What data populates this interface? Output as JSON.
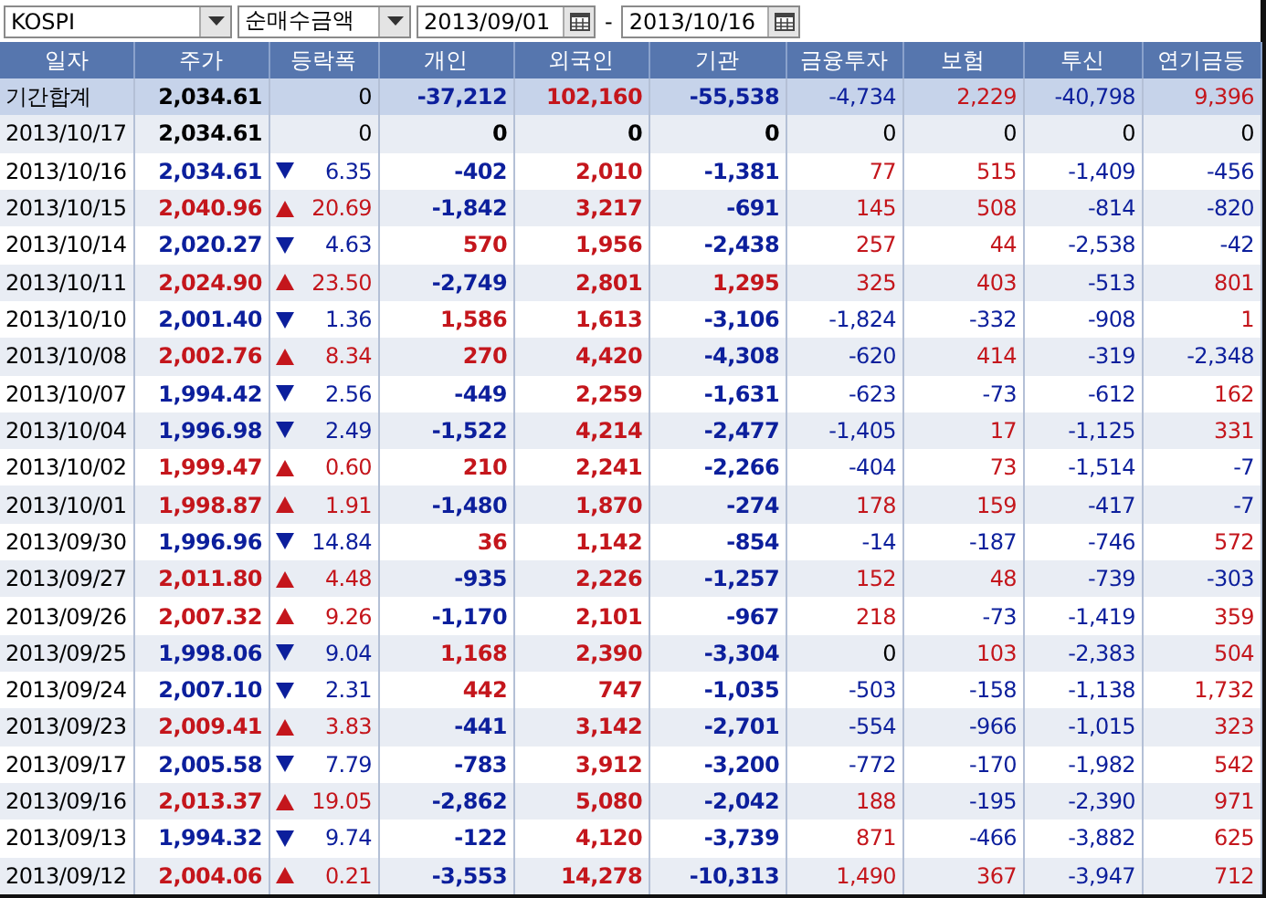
{
  "toolbar": {
    "market": "KOSPI",
    "metric": "순매수금액",
    "date_from": "2013/09/01",
    "separator": "-",
    "date_to": "2013/10/16"
  },
  "table": {
    "columns": [
      "일자",
      "주가",
      "등락폭",
      "개인",
      "외국인",
      "기관",
      "금융투자",
      "보험",
      "투신",
      "연기금등"
    ],
    "rows": [
      {
        "kind": "total",
        "date": "기간합계",
        "price": "2,034.61",
        "color": "#000000",
        "change": "0",
        "values": [
          {
            "text": "-37,212",
            "color": "#0c1f9c"
          },
          {
            "text": "102,160",
            "color": "#c4161c"
          },
          {
            "text": "-55,538",
            "color": "#0c1f9c"
          },
          {
            "text": "-4,734",
            "color": "#0c1f9c"
          },
          {
            "text": "2,229",
            "color": "#c4161c"
          },
          {
            "text": "-40,798",
            "color": "#0c1f9c"
          },
          {
            "text": "9,396",
            "color": "#c4161c"
          }
        ]
      },
      {
        "kind": "flat",
        "date": "2013/10/17",
        "price": "2,034.61",
        "color": "#000000",
        "change": "0",
        "values": [
          {
            "text": "0",
            "color": "#000000"
          },
          {
            "text": "0",
            "color": "#000000"
          },
          {
            "text": "0",
            "color": "#000000"
          },
          {
            "text": "0",
            "color": "#000000"
          },
          {
            "text": "0",
            "color": "#000000"
          },
          {
            "text": "0",
            "color": "#000000"
          },
          {
            "text": "0",
            "color": "#000000"
          }
        ]
      },
      {
        "kind": "down",
        "date": "2013/10/16",
        "price": "2,034.61",
        "color": "#0c1f9c",
        "change": "6.35",
        "values": [
          {
            "text": "-402",
            "color": "#0c1f9c"
          },
          {
            "text": "2,010",
            "color": "#c4161c"
          },
          {
            "text": "-1,381",
            "color": "#0c1f9c"
          },
          {
            "text": "77",
            "color": "#c4161c"
          },
          {
            "text": "515",
            "color": "#c4161c"
          },
          {
            "text": "-1,409",
            "color": "#0c1f9c"
          },
          {
            "text": "-456",
            "color": "#0c1f9c"
          }
        ]
      },
      {
        "kind": "up",
        "date": "2013/10/15",
        "price": "2,040.96",
        "color": "#c4161c",
        "change": "20.69",
        "values": [
          {
            "text": "-1,842",
            "color": "#0c1f9c"
          },
          {
            "text": "3,217",
            "color": "#c4161c"
          },
          {
            "text": "-691",
            "color": "#0c1f9c"
          },
          {
            "text": "145",
            "color": "#c4161c"
          },
          {
            "text": "508",
            "color": "#c4161c"
          },
          {
            "text": "-814",
            "color": "#0c1f9c"
          },
          {
            "text": "-820",
            "color": "#0c1f9c"
          }
        ]
      },
      {
        "kind": "down",
        "date": "2013/10/14",
        "price": "2,020.27",
        "color": "#0c1f9c",
        "change": "4.63",
        "values": [
          {
            "text": "570",
            "color": "#c4161c"
          },
          {
            "text": "1,956",
            "color": "#c4161c"
          },
          {
            "text": "-2,438",
            "color": "#0c1f9c"
          },
          {
            "text": "257",
            "color": "#c4161c"
          },
          {
            "text": "44",
            "color": "#c4161c"
          },
          {
            "text": "-2,538",
            "color": "#0c1f9c"
          },
          {
            "text": "-42",
            "color": "#0c1f9c"
          }
        ]
      },
      {
        "kind": "up",
        "date": "2013/10/11",
        "price": "2,024.90",
        "color": "#c4161c",
        "change": "23.50",
        "values": [
          {
            "text": "-2,749",
            "color": "#0c1f9c"
          },
          {
            "text": "2,801",
            "color": "#c4161c"
          },
          {
            "text": "1,295",
            "color": "#c4161c"
          },
          {
            "text": "325",
            "color": "#c4161c"
          },
          {
            "text": "403",
            "color": "#c4161c"
          },
          {
            "text": "-513",
            "color": "#0c1f9c"
          },
          {
            "text": "801",
            "color": "#c4161c"
          }
        ]
      },
      {
        "kind": "down",
        "date": "2013/10/10",
        "price": "2,001.40",
        "color": "#0c1f9c",
        "change": "1.36",
        "values": [
          {
            "text": "1,586",
            "color": "#c4161c"
          },
          {
            "text": "1,613",
            "color": "#c4161c"
          },
          {
            "text": "-3,106",
            "color": "#0c1f9c"
          },
          {
            "text": "-1,824",
            "color": "#0c1f9c"
          },
          {
            "text": "-332",
            "color": "#0c1f9c"
          },
          {
            "text": "-908",
            "color": "#0c1f9c"
          },
          {
            "text": "1",
            "color": "#c4161c"
          }
        ]
      },
      {
        "kind": "up",
        "date": "2013/10/08",
        "price": "2,002.76",
        "color": "#c4161c",
        "change": "8.34",
        "values": [
          {
            "text": "270",
            "color": "#c4161c"
          },
          {
            "text": "4,420",
            "color": "#c4161c"
          },
          {
            "text": "-4,308",
            "color": "#0c1f9c"
          },
          {
            "text": "-620",
            "color": "#0c1f9c"
          },
          {
            "text": "414",
            "color": "#c4161c"
          },
          {
            "text": "-319",
            "color": "#0c1f9c"
          },
          {
            "text": "-2,348",
            "color": "#0c1f9c"
          }
        ]
      },
      {
        "kind": "down",
        "date": "2013/10/07",
        "price": "1,994.42",
        "color": "#0c1f9c",
        "change": "2.56",
        "values": [
          {
            "text": "-449",
            "color": "#0c1f9c"
          },
          {
            "text": "2,259",
            "color": "#c4161c"
          },
          {
            "text": "-1,631",
            "color": "#0c1f9c"
          },
          {
            "text": "-623",
            "color": "#0c1f9c"
          },
          {
            "text": "-73",
            "color": "#0c1f9c"
          },
          {
            "text": "-612",
            "color": "#0c1f9c"
          },
          {
            "text": "162",
            "color": "#c4161c"
          }
        ]
      },
      {
        "kind": "down",
        "date": "2013/10/04",
        "price": "1,996.98",
        "color": "#0c1f9c",
        "change": "2.49",
        "values": [
          {
            "text": "-1,522",
            "color": "#0c1f9c"
          },
          {
            "text": "4,214",
            "color": "#c4161c"
          },
          {
            "text": "-2,477",
            "color": "#0c1f9c"
          },
          {
            "text": "-1,405",
            "color": "#0c1f9c"
          },
          {
            "text": "17",
            "color": "#c4161c"
          },
          {
            "text": "-1,125",
            "color": "#0c1f9c"
          },
          {
            "text": "331",
            "color": "#c4161c"
          }
        ]
      },
      {
        "kind": "up",
        "date": "2013/10/02",
        "price": "1,999.47",
        "color": "#c4161c",
        "change": "0.60",
        "values": [
          {
            "text": "210",
            "color": "#c4161c"
          },
          {
            "text": "2,241",
            "color": "#c4161c"
          },
          {
            "text": "-2,266",
            "color": "#0c1f9c"
          },
          {
            "text": "-404",
            "color": "#0c1f9c"
          },
          {
            "text": "73",
            "color": "#c4161c"
          },
          {
            "text": "-1,514",
            "color": "#0c1f9c"
          },
          {
            "text": "-7",
            "color": "#0c1f9c"
          }
        ]
      },
      {
        "kind": "up",
        "date": "2013/10/01",
        "price": "1,998.87",
        "color": "#c4161c",
        "change": "1.91",
        "values": [
          {
            "text": "-1,480",
            "color": "#0c1f9c"
          },
          {
            "text": "1,870",
            "color": "#c4161c"
          },
          {
            "text": "-274",
            "color": "#0c1f9c"
          },
          {
            "text": "178",
            "color": "#c4161c"
          },
          {
            "text": "159",
            "color": "#c4161c"
          },
          {
            "text": "-417",
            "color": "#0c1f9c"
          },
          {
            "text": "-7",
            "color": "#0c1f9c"
          }
        ]
      },
      {
        "kind": "down",
        "date": "2013/09/30",
        "price": "1,996.96",
        "color": "#0c1f9c",
        "change": "14.84",
        "values": [
          {
            "text": "36",
            "color": "#c4161c"
          },
          {
            "text": "1,142",
            "color": "#c4161c"
          },
          {
            "text": "-854",
            "color": "#0c1f9c"
          },
          {
            "text": "-14",
            "color": "#0c1f9c"
          },
          {
            "text": "-187",
            "color": "#0c1f9c"
          },
          {
            "text": "-746",
            "color": "#0c1f9c"
          },
          {
            "text": "572",
            "color": "#c4161c"
          }
        ]
      },
      {
        "kind": "up",
        "date": "2013/09/27",
        "price": "2,011.80",
        "color": "#c4161c",
        "change": "4.48",
        "values": [
          {
            "text": "-935",
            "color": "#0c1f9c"
          },
          {
            "text": "2,226",
            "color": "#c4161c"
          },
          {
            "text": "-1,257",
            "color": "#0c1f9c"
          },
          {
            "text": "152",
            "color": "#c4161c"
          },
          {
            "text": "48",
            "color": "#c4161c"
          },
          {
            "text": "-739",
            "color": "#0c1f9c"
          },
          {
            "text": "-303",
            "color": "#0c1f9c"
          }
        ]
      },
      {
        "kind": "up",
        "date": "2013/09/26",
        "price": "2,007.32",
        "color": "#c4161c",
        "change": "9.26",
        "values": [
          {
            "text": "-1,170",
            "color": "#0c1f9c"
          },
          {
            "text": "2,101",
            "color": "#c4161c"
          },
          {
            "text": "-967",
            "color": "#0c1f9c"
          },
          {
            "text": "218",
            "color": "#c4161c"
          },
          {
            "text": "-73",
            "color": "#0c1f9c"
          },
          {
            "text": "-1,419",
            "color": "#0c1f9c"
          },
          {
            "text": "359",
            "color": "#c4161c"
          }
        ]
      },
      {
        "kind": "down",
        "date": "2013/09/25",
        "price": "1,998.06",
        "color": "#0c1f9c",
        "change": "9.04",
        "values": [
          {
            "text": "1,168",
            "color": "#c4161c"
          },
          {
            "text": "2,390",
            "color": "#c4161c"
          },
          {
            "text": "-3,304",
            "color": "#0c1f9c"
          },
          {
            "text": "0",
            "color": "#000000"
          },
          {
            "text": "103",
            "color": "#c4161c"
          },
          {
            "text": "-2,383",
            "color": "#0c1f9c"
          },
          {
            "text": "504",
            "color": "#c4161c"
          }
        ]
      },
      {
        "kind": "down",
        "date": "2013/09/24",
        "price": "2,007.10",
        "color": "#0c1f9c",
        "change": "2.31",
        "values": [
          {
            "text": "442",
            "color": "#c4161c"
          },
          {
            "text": "747",
            "color": "#c4161c"
          },
          {
            "text": "-1,035",
            "color": "#0c1f9c"
          },
          {
            "text": "-503",
            "color": "#0c1f9c"
          },
          {
            "text": "-158",
            "color": "#0c1f9c"
          },
          {
            "text": "-1,138",
            "color": "#0c1f9c"
          },
          {
            "text": "1,732",
            "color": "#c4161c"
          }
        ]
      },
      {
        "kind": "up",
        "date": "2013/09/23",
        "price": "2,009.41",
        "color": "#c4161c",
        "change": "3.83",
        "values": [
          {
            "text": "-441",
            "color": "#0c1f9c"
          },
          {
            "text": "3,142",
            "color": "#c4161c"
          },
          {
            "text": "-2,701",
            "color": "#0c1f9c"
          },
          {
            "text": "-554",
            "color": "#0c1f9c"
          },
          {
            "text": "-966",
            "color": "#0c1f9c"
          },
          {
            "text": "-1,015",
            "color": "#0c1f9c"
          },
          {
            "text": "323",
            "color": "#c4161c"
          }
        ]
      },
      {
        "kind": "down",
        "date": "2013/09/17",
        "price": "2,005.58",
        "color": "#0c1f9c",
        "change": "7.79",
        "values": [
          {
            "text": "-783",
            "color": "#0c1f9c"
          },
          {
            "text": "3,912",
            "color": "#c4161c"
          },
          {
            "text": "-3,200",
            "color": "#0c1f9c"
          },
          {
            "text": "-772",
            "color": "#0c1f9c"
          },
          {
            "text": "-170",
            "color": "#0c1f9c"
          },
          {
            "text": "-1,982",
            "color": "#0c1f9c"
          },
          {
            "text": "542",
            "color": "#c4161c"
          }
        ]
      },
      {
        "kind": "up",
        "date": "2013/09/16",
        "price": "2,013.37",
        "color": "#c4161c",
        "change": "19.05",
        "values": [
          {
            "text": "-2,862",
            "color": "#0c1f9c"
          },
          {
            "text": "5,080",
            "color": "#c4161c"
          },
          {
            "text": "-2,042",
            "color": "#0c1f9c"
          },
          {
            "text": "188",
            "color": "#c4161c"
          },
          {
            "text": "-195",
            "color": "#0c1f9c"
          },
          {
            "text": "-2,390",
            "color": "#0c1f9c"
          },
          {
            "text": "971",
            "color": "#c4161c"
          }
        ]
      },
      {
        "kind": "down",
        "date": "2013/09/13",
        "price": "1,994.32",
        "color": "#0c1f9c",
        "change": "9.74",
        "values": [
          {
            "text": "-122",
            "color": "#0c1f9c"
          },
          {
            "text": "4,120",
            "color": "#c4161c"
          },
          {
            "text": "-3,739",
            "color": "#0c1f9c"
          },
          {
            "text": "871",
            "color": "#c4161c"
          },
          {
            "text": "-466",
            "color": "#0c1f9c"
          },
          {
            "text": "-3,882",
            "color": "#0c1f9c"
          },
          {
            "text": "625",
            "color": "#c4161c"
          }
        ]
      },
      {
        "kind": "up",
        "date": "2013/09/12",
        "price": "2,004.06",
        "color": "#c4161c",
        "change": "0.21",
        "values": [
          {
            "text": "-3,553",
            "color": "#0c1f9c"
          },
          {
            "text": "14,278",
            "color": "#c4161c"
          },
          {
            "text": "-10,313",
            "color": "#0c1f9c"
          },
          {
            "text": "1,490",
            "color": "#c4161c"
          },
          {
            "text": "367",
            "color": "#c4161c"
          },
          {
            "text": "-3,947",
            "color": "#0c1f9c"
          },
          {
            "text": "712",
            "color": "#c4161c"
          }
        ]
      }
    ]
  }
}
